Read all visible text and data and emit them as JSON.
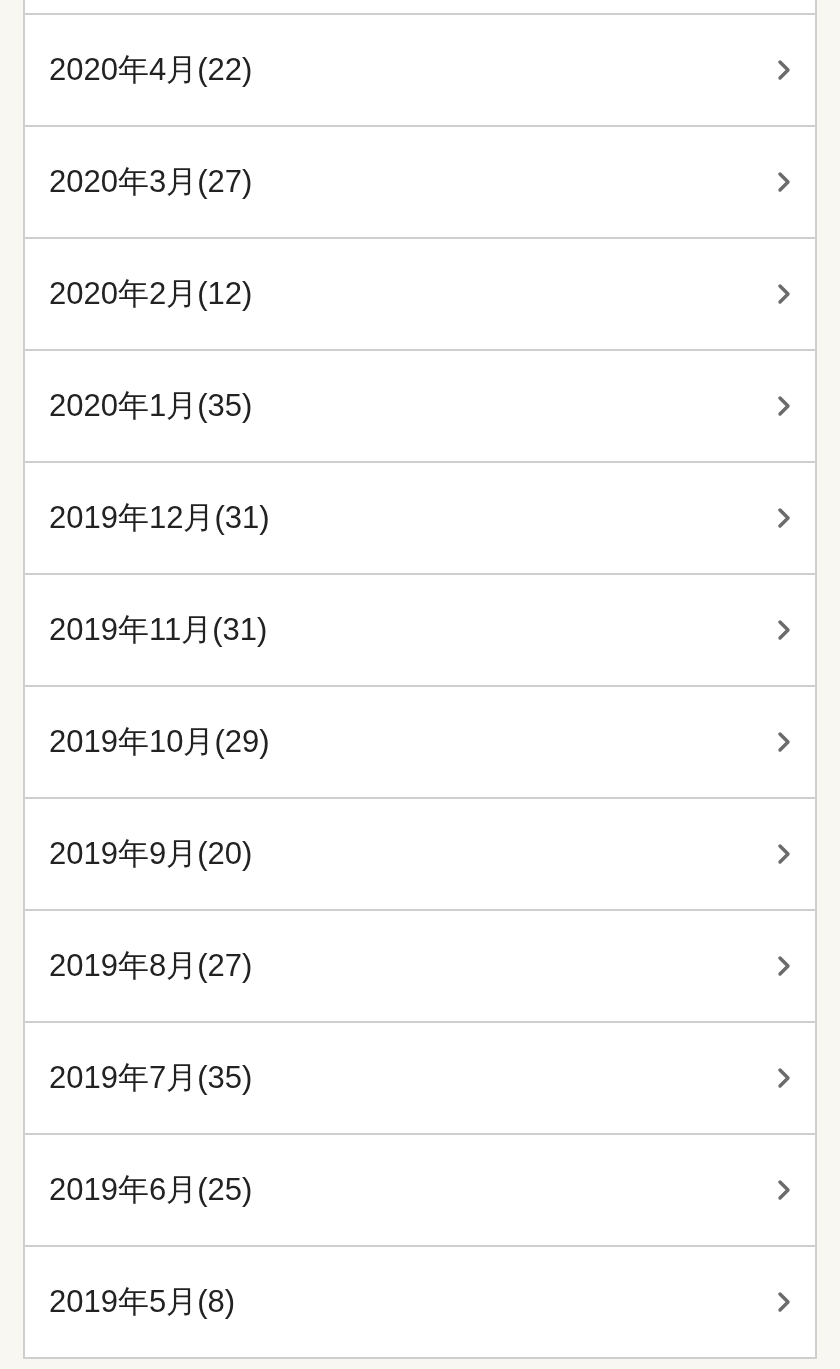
{
  "archive_items": [
    {
      "label": "2020年4月(22)"
    },
    {
      "label": "2020年3月(27)"
    },
    {
      "label": "2020年2月(12)"
    },
    {
      "label": "2020年1月(35)"
    },
    {
      "label": "2019年12月(31)"
    },
    {
      "label": "2019年11月(31)"
    },
    {
      "label": "2019年10月(29)"
    },
    {
      "label": "2019年9月(20)"
    },
    {
      "label": "2019年8月(27)"
    },
    {
      "label": "2019年7月(35)"
    },
    {
      "label": "2019年6月(25)"
    },
    {
      "label": "2019年5月(8)"
    }
  ]
}
